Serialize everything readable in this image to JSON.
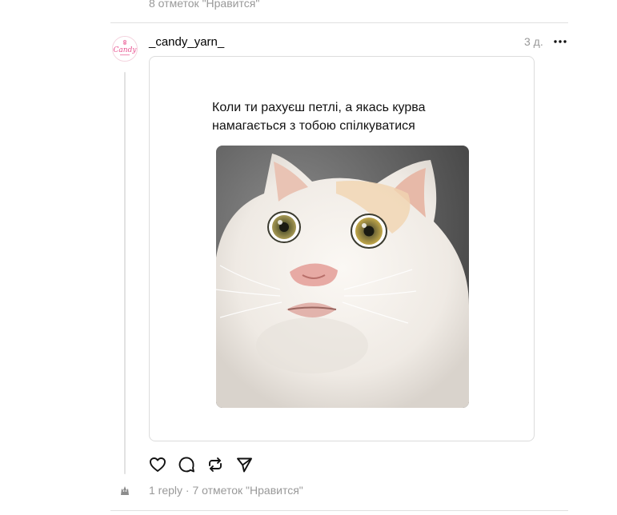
{
  "previous_post": {
    "likes_text": "8 отметок \"Нравится\""
  },
  "post": {
    "author": {
      "username": "_candy_yarn_",
      "avatar_text": "Candy",
      "avatar_color": "#e8508f"
    },
    "timestamp": "3 д.",
    "more_icon": "more-horizontal-icon",
    "media": {
      "caption_lines": [
        "Коли ти рахуєш петлі, а якась курва",
        "намагається з тобою спілкуватися"
      ],
      "image_subject": "white cat with startled face"
    },
    "actions": [
      {
        "name": "like-button",
        "icon": "heart-icon"
      },
      {
        "name": "comment-button",
        "icon": "speech-bubble-icon"
      },
      {
        "name": "repost-button",
        "icon": "repost-icon"
      },
      {
        "name": "share-button",
        "icon": "paper-plane-icon"
      }
    ],
    "footer": {
      "replies": "1 reply",
      "separator": "·",
      "likes": "7 отметок \"Нравится\""
    }
  },
  "colors": {
    "muted_text": "#999999",
    "divider": "#e0e0e0",
    "brand_pink": "#e8508f"
  }
}
